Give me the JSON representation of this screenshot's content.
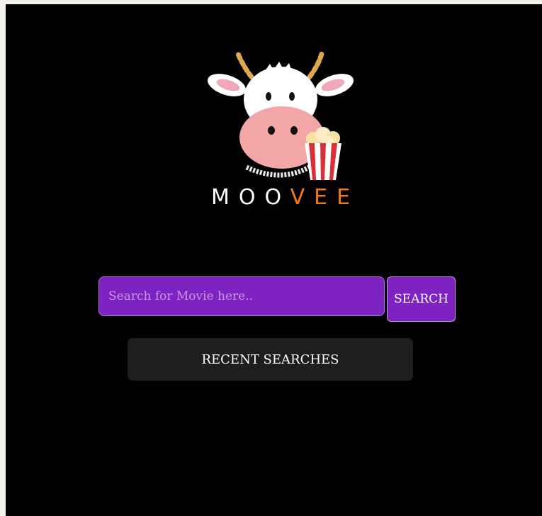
{
  "brand": {
    "name_part1": "MOO",
    "name_part2": "VEE",
    "accent_color": "#f07a1e",
    "logo_icon": "cow-with-popcorn-logo"
  },
  "search": {
    "placeholder": "Search for Movie here..",
    "value": "",
    "button_label": "SEARCH",
    "button_color": "#7e22c2"
  },
  "recent": {
    "button_label": "RECENT SEARCHES"
  },
  "theme": {
    "background": "#000000",
    "text": "#ffffff"
  }
}
